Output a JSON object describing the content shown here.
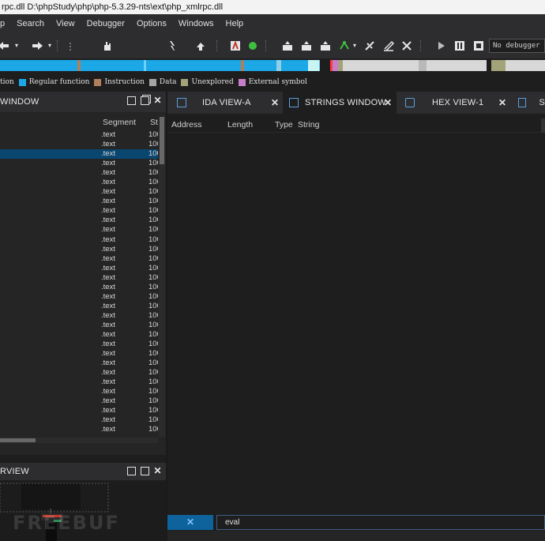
{
  "window": {
    "title": "rpc.dll D:\\phpStudy\\php\\php-5.3.29-nts\\ext\\php_xmlrpc.dll"
  },
  "menu": [
    "p",
    "Search",
    "View",
    "Debugger",
    "Options",
    "Windows",
    "Help"
  ],
  "toolbar": {
    "debugger_select": "No debugger",
    "icons": [
      "back-arrow-icon",
      "forward-arrow-icon",
      "hand-icon",
      "jump-icon",
      "pointer-icon",
      "text-icon",
      "green-circle-icon",
      "patch-icon",
      "patch-icon",
      "patch-icon",
      "patch-icon",
      "graph-icon",
      "step-icon",
      "edit-icon",
      "cross-icon",
      "play-icon",
      "pause-icon",
      "stop-icon"
    ]
  },
  "legend": [
    {
      "label": "tion",
      "color": "#2f2f2f"
    },
    {
      "label": "Regular function",
      "color": "#1ca8e6"
    },
    {
      "label": "Instruction",
      "color": "#b07f5c"
    },
    {
      "label": "Data",
      "color": "#a6a6a6"
    },
    {
      "label": "Unexplored",
      "color": "#a3a37a"
    },
    {
      "label": "External symbol",
      "color": "#c77dc7"
    }
  ],
  "functions_pane": {
    "title": "WINDOW",
    "columns": {
      "segment": "Segment",
      "start": "St"
    },
    "rows": [
      {
        "segment": ".text",
        "start": "100"
      },
      {
        "segment": ".text",
        "start": "100"
      },
      {
        "segment": ".text",
        "start": "100"
      },
      {
        "segment": ".text",
        "start": "100"
      },
      {
        "segment": ".text",
        "start": "100"
      },
      {
        "segment": ".text",
        "start": "100"
      },
      {
        "segment": ".text",
        "start": "100"
      },
      {
        "segment": ".text",
        "start": "100"
      },
      {
        "segment": ".text",
        "start": "100"
      },
      {
        "segment": ".text",
        "start": "100"
      },
      {
        "segment": ".text",
        "start": "100"
      },
      {
        "segment": ".text",
        "start": "100"
      },
      {
        "segment": ".text",
        "start": "100"
      },
      {
        "segment": ".text",
        "start": "100"
      },
      {
        "segment": ".text",
        "start": "100"
      },
      {
        "segment": ".text",
        "start": "100"
      },
      {
        "segment": ".text",
        "start": "100"
      },
      {
        "segment": ".text",
        "start": "100"
      },
      {
        "segment": ".text",
        "start": "100"
      },
      {
        "segment": ".text",
        "start": "100"
      },
      {
        "segment": ".text",
        "start": "100"
      },
      {
        "segment": ".text",
        "start": "100"
      },
      {
        "segment": ".text",
        "start": "100"
      },
      {
        "segment": ".text",
        "start": "100"
      },
      {
        "segment": ".text",
        "start": "100"
      },
      {
        "segment": ".text",
        "start": "100"
      },
      {
        "segment": ".text",
        "start": "100"
      },
      {
        "segment": ".text",
        "start": "100"
      },
      {
        "segment": ".text",
        "start": "100"
      },
      {
        "segment": ".text",
        "start": "100"
      },
      {
        "segment": ".text",
        "start": "100"
      },
      {
        "segment": ".text",
        "start": "100"
      }
    ]
  },
  "overview_pane": {
    "title": "RVIEW"
  },
  "tabs": [
    {
      "label": "IDA VIEW-A",
      "icon": "ida-view-icon",
      "active": false
    },
    {
      "label": "STRINGS WINDOW",
      "icon": "strings-icon",
      "active": true
    },
    {
      "label": "HEX VIEW-1",
      "icon": "hex-view-icon",
      "active": false
    },
    {
      "label": "S",
      "icon": "structures-icon",
      "active": false
    }
  ],
  "strings_window": {
    "columns": {
      "address": "Address",
      "length": "Length",
      "type": "Type",
      "string": "String"
    }
  },
  "search": {
    "value": "eval"
  },
  "watermark": "FREEBUF"
}
